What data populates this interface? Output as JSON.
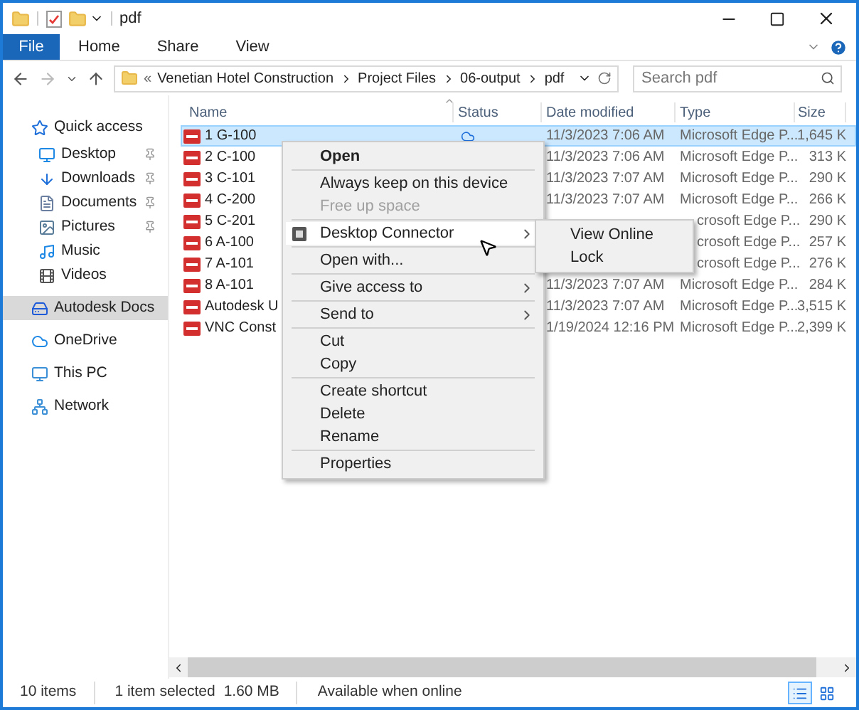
{
  "window": {
    "title": "pdf"
  },
  "ribbon": {
    "tabs": [
      {
        "label": "File",
        "kind": "file"
      },
      {
        "label": "Home",
        "kind": "tab"
      },
      {
        "label": "Share",
        "kind": "tab"
      },
      {
        "label": "View",
        "kind": "tab"
      }
    ]
  },
  "address_bar": {
    "overflow": "«",
    "crumbs": [
      "Venetian Hotel Construction",
      "Project Files",
      "06-output",
      "pdf"
    ]
  },
  "search": {
    "placeholder": "Search pdf"
  },
  "nav_pane": {
    "items": [
      {
        "label": "Quick access",
        "kind": "star",
        "selected": false,
        "children": [
          {
            "label": "Desktop",
            "kind": "desktop",
            "pinned": true
          },
          {
            "label": "Downloads",
            "kind": "download",
            "pinned": true
          },
          {
            "label": "Documents",
            "kind": "document",
            "pinned": true
          },
          {
            "label": "Pictures",
            "kind": "pictures",
            "pinned": true
          },
          {
            "label": "Music",
            "kind": "music",
            "pinned": false
          },
          {
            "label": "Videos",
            "kind": "videos",
            "pinned": false
          }
        ]
      },
      {
        "label": "Autodesk Docs",
        "kind": "docs",
        "selected": true
      },
      {
        "label": "OneDrive",
        "kind": "cloud",
        "selected": false
      },
      {
        "label": "This PC",
        "kind": "pc",
        "selected": false
      },
      {
        "label": "Network",
        "kind": "network",
        "selected": false
      }
    ]
  },
  "table": {
    "columns": [
      "Name",
      "Status",
      "Date modified",
      "Type",
      "Size"
    ],
    "rows": [
      {
        "name": "1 G-100",
        "online_only": true,
        "date": "11/3/2023 7:06 AM",
        "type": "Microsoft Edge P...",
        "size": "1,645 K",
        "selected": true
      },
      {
        "name": "2 C-100",
        "date": "11/3/2023 7:06 AM",
        "type": "Microsoft Edge P...",
        "size": "313 K",
        "selected": false
      },
      {
        "name": "3 C-101",
        "date": "11/3/2023 7:07 AM",
        "type": "Microsoft Edge P...",
        "size": "290 K",
        "selected": false
      },
      {
        "name": "4 C-200",
        "date": "11/3/2023 7:07 AM",
        "type": "Microsoft Edge P...",
        "size": "266 K",
        "selected": false
      },
      {
        "name": "5 C-201",
        "type": "crosoft Edge P...",
        "size": "290 K",
        "selected": false
      },
      {
        "name": "6 A-100",
        "type": "crosoft Edge P...",
        "size": "257 K",
        "selected": false
      },
      {
        "name": "7 A-101",
        "type": "crosoft Edge P...",
        "size": "276 K",
        "selected": false
      },
      {
        "name": "8 A-101",
        "date": "11/3/2023 7:07 AM",
        "type": "Microsoft Edge P...",
        "size": "284 K",
        "selected": false
      },
      {
        "name": "Autodesk U",
        "date": "11/3/2023 7:07 AM",
        "type": "Microsoft Edge P...",
        "size": "3,515 K",
        "selected": false
      },
      {
        "name": "VNC Const",
        "date": "1/19/2024 12:16 PM",
        "type": "Microsoft Edge P...",
        "size": "2,399 K",
        "selected": false
      }
    ]
  },
  "context_menu": {
    "groups": [
      [
        {
          "label": "Open",
          "bold": true
        }
      ],
      [
        {
          "label": "Always keep on this device"
        },
        {
          "label": "Free up space",
          "disabled": true
        }
      ],
      [
        {
          "label": "Desktop Connector",
          "submenu": true,
          "selected": true,
          "icon": true
        }
      ],
      [
        {
          "label": "Open with..."
        }
      ],
      [
        {
          "label": "Give access to",
          "submenu": true
        }
      ],
      [
        {
          "label": "Send to",
          "submenu": true
        }
      ],
      [
        {
          "label": "Cut"
        },
        {
          "label": "Copy"
        }
      ],
      [
        {
          "label": "Create shortcut"
        },
        {
          "label": "Delete"
        },
        {
          "label": "Rename"
        }
      ],
      [
        {
          "label": "Properties"
        }
      ]
    ]
  },
  "submenu": {
    "items": [
      "View Online",
      "Lock"
    ]
  },
  "status_bar": {
    "items": [
      "10 items",
      "1 item selected",
      "1.60 MB",
      "Available when online"
    ],
    "views": [
      {
        "kind": "details",
        "selected": true
      },
      {
        "kind": "tiles",
        "selected": false
      }
    ]
  }
}
